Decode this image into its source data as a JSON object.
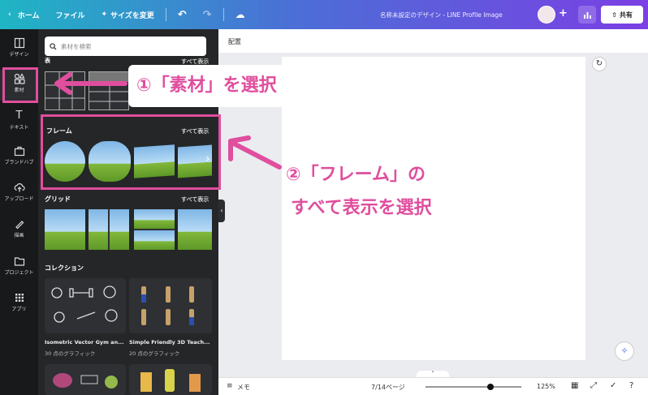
{
  "topbar": {
    "home": "ホーム",
    "file": "ファイル",
    "resize": "サイズを変更",
    "title": "名称未設定のデザイン - LINE Profile Image",
    "share": "共有"
  },
  "rail": {
    "items": [
      {
        "label": "デザイン"
      },
      {
        "label": "素材"
      },
      {
        "label": "テキスト"
      },
      {
        "label": "ブランドハブ"
      },
      {
        "label": "アップロード"
      },
      {
        "label": "描画"
      },
      {
        "label": "プロジェクト"
      },
      {
        "label": "アプリ"
      }
    ]
  },
  "panel": {
    "search_placeholder": "素材を検索",
    "table_section": "表",
    "table_see_all": "すべて表示",
    "frames_title": "フレーム",
    "frames_see_all": "すべて表示",
    "grids_title": "グリッド",
    "grids_see_all": "すべて表示",
    "collections_title": "コレクション",
    "collections": [
      {
        "name": "Isometric Vector Gym an...",
        "count": "30 点のグラフィック"
      },
      {
        "name": "Simple Friendly 3D Teach...",
        "count": "20 点のグラフィック"
      }
    ]
  },
  "main": {
    "top_label": "配置",
    "memo": "メモ",
    "page_indicator": "7/14ページ",
    "zoom": "125%"
  },
  "annotations": {
    "callout1": "①「素材」を選択",
    "callout2_line1": "②「フレーム」の",
    "callout2_line2": "すべて表示を選択"
  },
  "colors": {
    "accent": "#e04e9e",
    "panel_bg": "#252627",
    "rail_bg": "#18191b"
  }
}
